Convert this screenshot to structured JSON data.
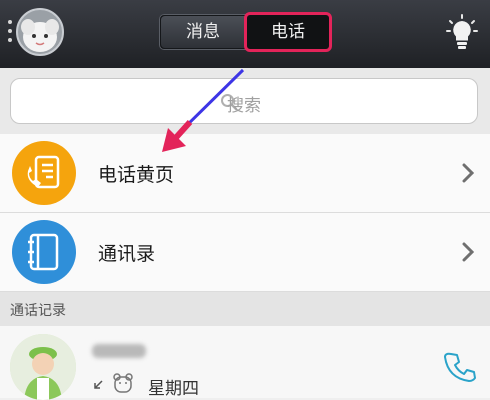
{
  "header": {
    "tabs": [
      {
        "label": "消息"
      },
      {
        "label": "电话"
      }
    ]
  },
  "search": {
    "placeholder": "搜索"
  },
  "menu": [
    {
      "label": "电话黄页",
      "icon": "phonebook-icon",
      "color": "#f5a40d"
    },
    {
      "label": "通讯录",
      "icon": "contacts-book-icon",
      "color": "#2f8fd9"
    }
  ],
  "section": {
    "title": "通话记录"
  },
  "call_log": [
    {
      "date": "星期四"
    }
  ],
  "colors": {
    "highlight": "#e3245a",
    "arrow": "#e3245a"
  }
}
